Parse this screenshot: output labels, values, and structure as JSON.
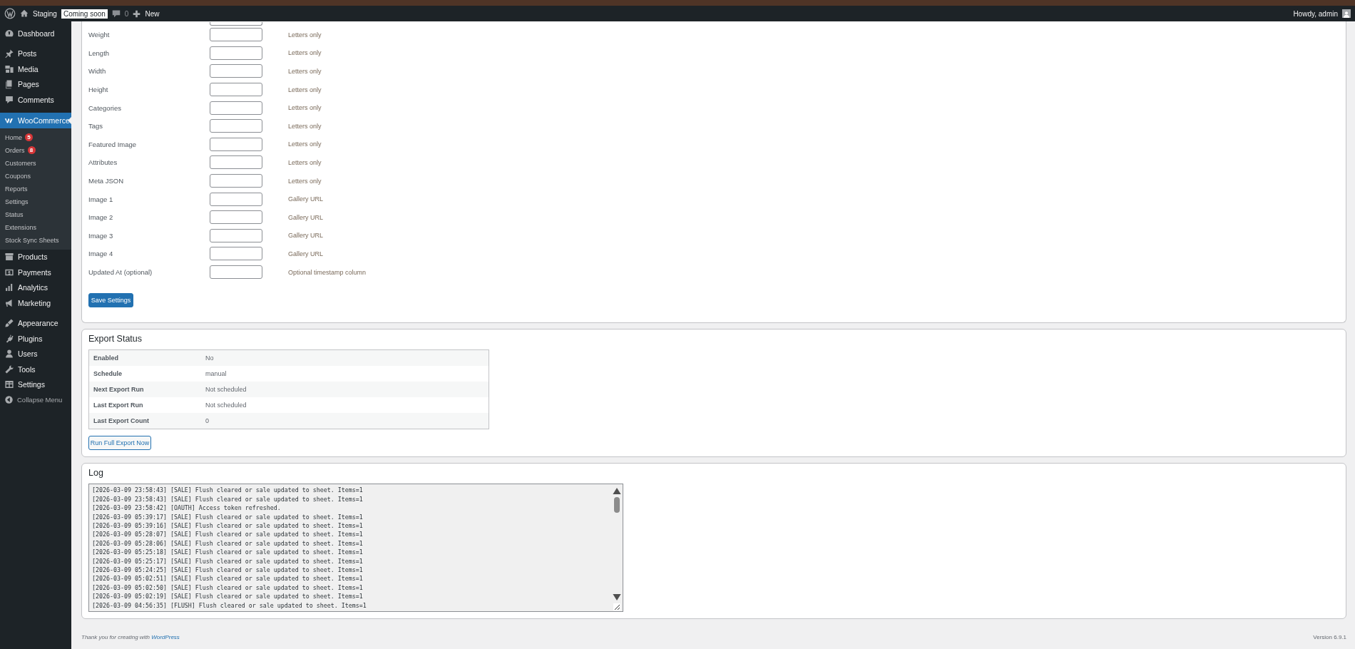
{
  "admin_bar": {
    "site": "Staging",
    "badge": "Coming soon",
    "comments": "0",
    "new": "New",
    "greeting": "Howdy, admin"
  },
  "sidebar": {
    "items": [
      {
        "label": "Dashboard",
        "selected": false
      },
      {
        "label": "Posts",
        "selected": false
      },
      {
        "label": "Media",
        "selected": false
      },
      {
        "label": "Pages",
        "selected": false
      },
      {
        "label": "Comments",
        "selected": false
      },
      {
        "label": "WooCommerce",
        "selected": true,
        "children": [
          {
            "label": "Home",
            "badge": "5",
            "selected": false
          },
          {
            "label": "Orders",
            "badge": "8",
            "selected": false
          },
          {
            "label": "Customers",
            "selected": false
          },
          {
            "label": "Coupons",
            "selected": false
          },
          {
            "label": "Reports",
            "selected": false
          },
          {
            "label": "Settings",
            "selected": false
          },
          {
            "label": "Status",
            "selected": false
          },
          {
            "label": "Extensions",
            "selected": false
          },
          {
            "label": "Stock Sync Sheets",
            "selected": false
          }
        ]
      },
      {
        "label": "Products",
        "selected": false
      },
      {
        "label": "Payments",
        "selected": false
      },
      {
        "label": "Analytics",
        "selected": false
      },
      {
        "label": "Marketing",
        "selected": false
      },
      {
        "label": "Appearance",
        "selected": false
      },
      {
        "label": "Plugins",
        "selected": false
      },
      {
        "label": "Users",
        "selected": false
      },
      {
        "label": "Tools",
        "selected": false
      },
      {
        "label": "Settings",
        "selected": false
      }
    ],
    "collapse": "Collapse Menu"
  },
  "mapping": {
    "fields": [
      {
        "label": "Weight",
        "hint": "Letters only"
      },
      {
        "label": "Length",
        "hint": "Letters only"
      },
      {
        "label": "Width",
        "hint": "Letters only"
      },
      {
        "label": "Height",
        "hint": "Letters only"
      },
      {
        "label": "Categories",
        "hint": "Letters only"
      },
      {
        "label": "Tags",
        "hint": "Letters only"
      },
      {
        "label": "Featured Image",
        "hint": "Letters only"
      },
      {
        "label": "Attributes",
        "hint": "Letters only"
      },
      {
        "label": "Meta JSON",
        "hint": "Letters only"
      },
      {
        "label": "Image 1",
        "hint": "Gallery URL"
      },
      {
        "label": "Image 2",
        "hint": "Gallery URL"
      },
      {
        "label": "Image 3",
        "hint": "Gallery URL"
      },
      {
        "label": "Image 4",
        "hint": "Gallery URL"
      },
      {
        "label": "Updated At (optional)",
        "hint": "Optional timestamp column"
      }
    ],
    "save_button": "Save Settings"
  },
  "export_status": {
    "title": "Export Status",
    "rows": [
      {
        "label": "Enabled",
        "value": "No"
      },
      {
        "label": "Schedule",
        "value": "manual"
      },
      {
        "label": "Next Export Run",
        "value": "Not scheduled"
      },
      {
        "label": "Last Export Run",
        "value": "Not scheduled"
      },
      {
        "label": "Last Export Count",
        "value": "0"
      }
    ],
    "button": "Run Full Export Now"
  },
  "log": {
    "title": "Log",
    "lines": [
      "[2026-03-09 23:58:43] [SALE] Flush cleared or sale updated to sheet. Items=1",
      "[2026-03-09 23:58:43] [SALE] Flush cleared or sale updated to sheet. Items=1",
      "[2026-03-09 23:58:42] [OAUTH] Access token refreshed.",
      "[2026-03-09 05:39:17] [SALE] Flush cleared or sale updated to sheet. Items=1",
      "[2026-03-09 05:39:16] [SALE] Flush cleared or sale updated to sheet. Items=1",
      "[2026-03-09 05:28:07] [SALE] Flush cleared or sale updated to sheet. Items=1",
      "[2026-03-09 05:28:06] [SALE] Flush cleared or sale updated to sheet. Items=1",
      "[2026-03-09 05:25:18] [SALE] Flush cleared or sale updated to sheet. Items=1",
      "[2026-03-09 05:25:17] [SALE] Flush cleared or sale updated to sheet. Items=1",
      "[2026-03-09 05:24:25] [SALE] Flush cleared or sale updated to sheet. Items=1",
      "[2026-03-09 05:02:51] [SALE] Flush cleared or sale updated to sheet. Items=1",
      "[2026-03-09 05:02:50] [SALE] Flush cleared or sale updated to sheet. Items=1",
      "[2026-03-09 05:02:19] [SALE] Flush cleared or sale updated to sheet. Items=1",
      "[2026-03-09 04:56:35] [FLUSH] Flush cleared or sale updated to sheet. Items=1"
    ]
  },
  "footer": {
    "thanks": "Thank you for creating with",
    "link": "WordPress",
    "version": "Version 6.9.1"
  }
}
